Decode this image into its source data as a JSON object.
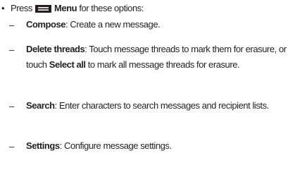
{
  "intro": {
    "bullet": "•",
    "press": "Press",
    "menu_icon": "menu-icon",
    "menu_label": "Menu",
    "rest": "for these options:"
  },
  "items": [
    {
      "dash": "–",
      "term": "Compose",
      "desc": ": Create a new message."
    },
    {
      "dash": "–",
      "term": "Delete threads",
      "desc_a": ": Touch message threads to mark them for erasure, or touch ",
      "term2": "Select all",
      "desc_b": " to mark all message threads for erasure."
    },
    {
      "dash": "–",
      "term": "Search",
      "desc": ": Enter characters to search messages and recipient lists."
    },
    {
      "dash": "–",
      "term": "Settings",
      "desc": ": Configure message settings."
    }
  ]
}
